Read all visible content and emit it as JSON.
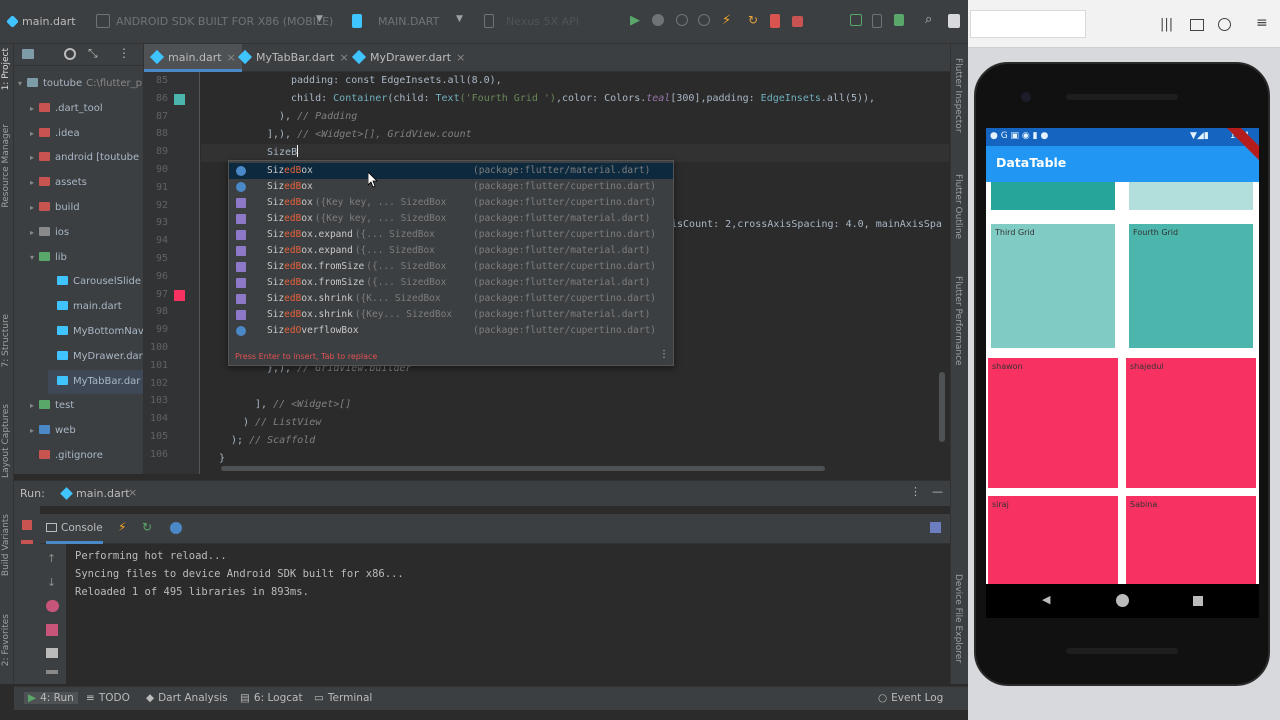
{
  "toolbar": {
    "file_chip": "main.dart",
    "device": "ANDROID SDK BUILT FOR X86 (MOBILE)",
    "config": "MAIN.DART",
    "emulator": "Nexus 5X API"
  },
  "side_labels": {
    "project": "1: Project",
    "resource": "Resource Manager",
    "structure": "7: Structure",
    "layout": "Layout Captures",
    "build": "Build Variants",
    "favorites": "2: Favorites"
  },
  "right_labels": {
    "inspector": "Flutter Inspector",
    "outline": "Flutter Outline",
    "performance": "Flutter Performance",
    "explorer": "Device File Explorer"
  },
  "project_tree": [
    {
      "label": "toutube",
      "extra": "C:\\flutter_p",
      "arrow": "▾"
    },
    {
      "label": ".dart_tool",
      "arrow": "▸"
    },
    {
      "label": ".idea",
      "arrow": "▸"
    },
    {
      "label": "android [toutube",
      "arrow": "▸"
    },
    {
      "label": "assets",
      "arrow": "▸"
    },
    {
      "label": "build",
      "arrow": "▸"
    },
    {
      "label": "ios",
      "arrow": "▸"
    },
    {
      "label": "lib",
      "arrow": "▾"
    },
    {
      "label": "CarouselSlide",
      "arrow": ""
    },
    {
      "label": "main.dart",
      "arrow": ""
    },
    {
      "label": "MyBottomNav",
      "arrow": ""
    },
    {
      "label": "MyDrawer.dart",
      "arrow": ""
    },
    {
      "label": "MyTabBar.dar",
      "arrow": ""
    },
    {
      "label": "test",
      "arrow": "▸"
    },
    {
      "label": "web",
      "arrow": "▸"
    },
    {
      "label": ".gitignore",
      "arrow": ""
    }
  ],
  "tabs": [
    "main.dart",
    "MyTabBar.dart",
    "MyDrawer.dart"
  ],
  "line_numbers": [
    "85",
    "86",
    "87",
    "88",
    "89",
    "90",
    "91",
    "92",
    "93",
    "94",
    "95",
    "96",
    "97",
    "98",
    "99",
    "100",
    "101",
    "102",
    "103",
    "104",
    "105",
    "106"
  ],
  "code": {
    "l85": "padding: const EdgeInsets.all(8.0),",
    "l86_a": "child: ",
    "l86_b": "Container",
    "l86_c": "(child: ",
    "l86_d": "Text",
    "l86_e": "('Fourth Grid ')",
    "l86_f": ",color: Colors.",
    "l86_g": "teal",
    "l86_h": "[300]",
    "l86_i": ",padding: ",
    "l86_j": "EdgeInsets",
    "l86_k": ".all(5)),",
    "l87_a": "), ",
    "l87_b": "// Padding",
    "l88_a": "],), ",
    "l88_b": "// <Widget>[], GridView.count",
    "l89": "SizeB",
    "l93": "isCount: 2,crossAxisSpacing: 4.0, mainAxisSpa",
    "l101_a": "},), ",
    "l101_b": "// GridView.builder",
    "l103_a": "], ",
    "l103_b": "// <Widget>[]",
    "l104_a": ") ",
    "l104_b": "// ListView",
    "l105_a": "); ",
    "l105_b": "// Scaffold",
    "l106": "}"
  },
  "popup": {
    "items": [
      {
        "pre": "Siz",
        "hl": "edB",
        "post": "ox",
        "sig": "",
        "pkg": "(package:flutter/material.dart)",
        "kind": "class"
      },
      {
        "pre": "Siz",
        "hl": "edB",
        "post": "ox",
        "sig": "",
        "pkg": "(package:flutter/cupertino.dart)",
        "kind": "class"
      },
      {
        "pre": "Siz",
        "hl": "edB",
        "post": "ox",
        "sig": "({Key key, ...  SizedBox",
        "pkg": "(package:flutter/cupertino.dart)",
        "kind": "method"
      },
      {
        "pre": "Siz",
        "hl": "edB",
        "post": "ox",
        "sig": "({Key key, ...  SizedBox",
        "pkg": "(package:flutter/material.dart)",
        "kind": "method"
      },
      {
        "pre": "Siz",
        "hl": "edB",
        "post": "ox.expand",
        "sig": "({...  SizedBox",
        "pkg": "(package:flutter/cupertino.dart)",
        "kind": "method"
      },
      {
        "pre": "Siz",
        "hl": "edB",
        "post": "ox.expand",
        "sig": "({...  SizedBox",
        "pkg": "(package:flutter/material.dart)",
        "kind": "method"
      },
      {
        "pre": "Siz",
        "hl": "edB",
        "post": "ox.fromSize",
        "sig": "({...  SizedBox",
        "pkg": "(package:flutter/cupertino.dart)",
        "kind": "method"
      },
      {
        "pre": "Siz",
        "hl": "edB",
        "post": "ox.fromSize",
        "sig": "({...  SizedBox",
        "pkg": "(package:flutter/material.dart)",
        "kind": "method"
      },
      {
        "pre": "Siz",
        "hl": "edB",
        "post": "ox.shrink",
        "sig": "({K...  SizedBox",
        "pkg": "(package:flutter/cupertino.dart)",
        "kind": "method"
      },
      {
        "pre": "Siz",
        "hl": "edB",
        "post": "ox.shrink",
        "sig": "({Key...  SizedBox",
        "pkg": "(package:flutter/material.dart)",
        "kind": "method"
      },
      {
        "pre": "Siz",
        "hl": "edO",
        "post": "verflowBox",
        "sig": "",
        "pkg": "(package:flutter/cupertino.dart)",
        "kind": "class"
      }
    ],
    "footer": "Press Enter to insert, Tab to replace"
  },
  "run": {
    "label": "Run:",
    "tab": "main.dart",
    "console_tab": "Console",
    "lines": [
      "Performing hot reload...",
      "Syncing files to device Android SDK built for x86...",
      "Reloaded 1 of 495 libraries in 893ms."
    ]
  },
  "status": {
    "run": "4: Run",
    "todo": "TODO",
    "dart": "Dart Analysis",
    "logcat": "6: Logcat",
    "terminal": "Terminal",
    "eventlog": "Event Log"
  },
  "phone": {
    "time": "1:44",
    "title": "DataTable",
    "teal_cells": [
      "Third Grid",
      "Fourth Grid"
    ],
    "pink_cells": [
      "shawon",
      "shajedul",
      "siraj",
      "Sabina"
    ],
    "colors": {
      "appbar": "#2196f3",
      "teal_dark": "#26a69a",
      "teal_light": "#80cbc4",
      "pink": "#f73162"
    }
  }
}
